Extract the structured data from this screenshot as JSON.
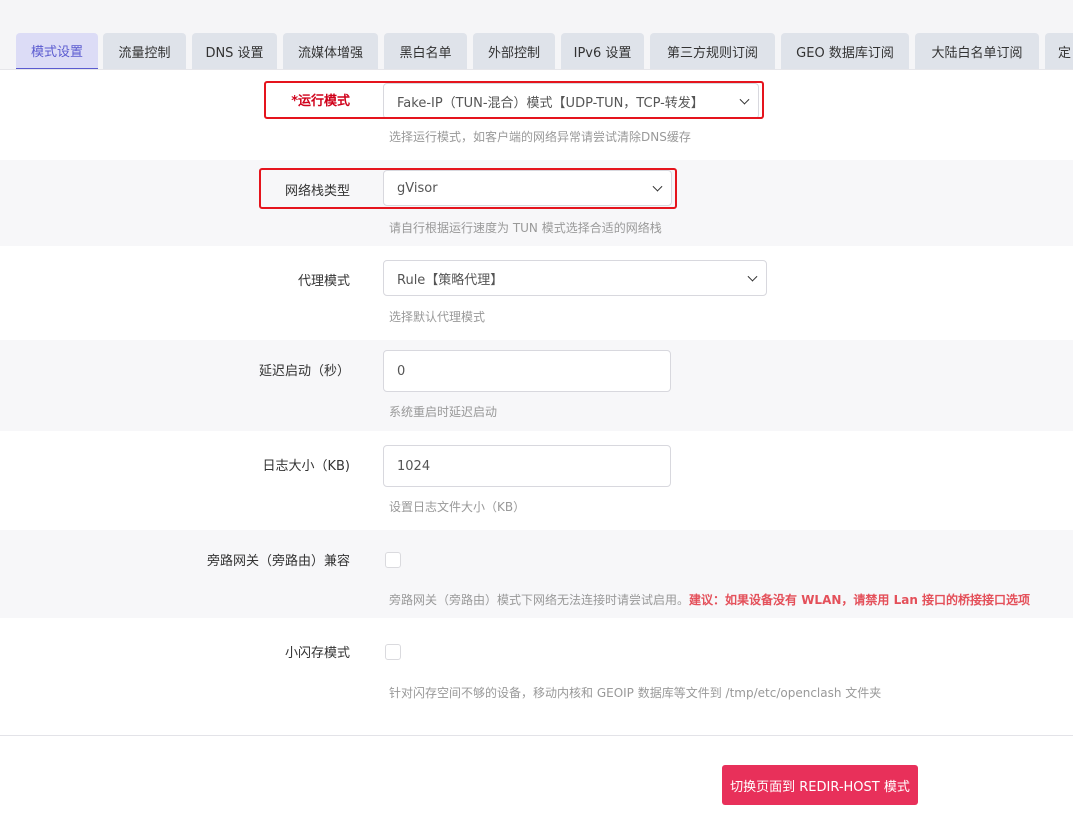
{
  "tabs": [
    {
      "label": "模式设置",
      "active": true
    },
    {
      "label": "流量控制"
    },
    {
      "label": "DNS 设置"
    },
    {
      "label": "流媒体增强"
    },
    {
      "label": "黑白名单"
    },
    {
      "label": "外部控制"
    },
    {
      "label": "IPv6 设置"
    },
    {
      "label": "第三方规则订阅"
    },
    {
      "label": "GEO 数据库订阅"
    },
    {
      "label": "大陆白名单订阅"
    },
    {
      "label": "定"
    }
  ],
  "run_mode": {
    "label": "*运行模式",
    "value": "Fake-IP（TUN-混合）模式【UDP-TUN，TCP-转发】",
    "hint": "选择运行模式，如客户端的网络异常请尝试清除DNS缓存"
  },
  "stack_type": {
    "label": "网络栈类型",
    "value": "gVisor",
    "hint": "请自行根据运行速度为 TUN 模式选择合适的网络栈"
  },
  "proxy_mode": {
    "label": "代理模式",
    "value": "Rule【策略代理】",
    "hint": "选择默认代理模式"
  },
  "delay_start": {
    "label": "延迟启动（秒）",
    "value": "0",
    "hint": "系统重启时延迟启动"
  },
  "log_size": {
    "label": "日志大小（KB)",
    "value": "1024",
    "hint": "设置日志文件大小（KB）"
  },
  "bypass_gateway": {
    "label": "旁路网关（旁路由）兼容",
    "hint": "旁路网关（旁路由）模式下网络无法连接时请尝试启用。",
    "warn": "建议：如果设备没有 WLAN，请禁用 Lan 接口的桥接接口选项"
  },
  "small_flash": {
    "label": "小闪存模式",
    "hint": "针对闪存空间不够的设备，移动内核和 GEOIP 数据库等文件到 /tmp/etc/openclash 文件夹"
  },
  "switch_button": "切换页面到 REDIR-HOST 模式",
  "colors": {
    "accent": "#5b5bd0",
    "highlight_box": "#e5141d",
    "button": "#e8305a"
  }
}
